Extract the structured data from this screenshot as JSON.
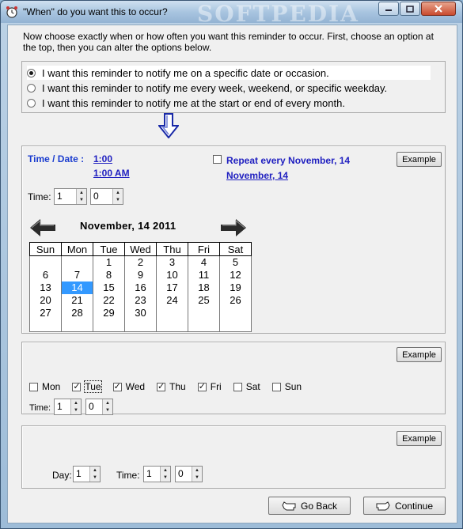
{
  "window": {
    "title": "\"When\" do you want this to occur?",
    "watermark": "SOFTPEDIA"
  },
  "intro": "Now choose exactly when or how often you want this reminder to occur.  First, choose an option at the top, then you can alter the options below.",
  "options": [
    {
      "label": "I want this reminder to notify me on a specific date or occasion.",
      "selected": true
    },
    {
      "label": "I want this reminder to notify me every week, weekend, or specific weekday.",
      "selected": false
    },
    {
      "label": "I want this reminder to notify me at the start or end of every month.",
      "selected": false
    }
  ],
  "date_panel": {
    "time_date_label": "Time / Date :",
    "time_link": "1:00",
    "time_ampm_link": "1:00 AM",
    "repeat_label": "Repeat every November, 14",
    "repeat_checked": false,
    "repeat_date_link": "November, 14",
    "example_label": "Example",
    "time_label": "Time:",
    "hour_value": "1",
    "minute_value": "0",
    "calendar": {
      "title": "November, 14  2011",
      "headers": [
        "Sun",
        "Mon",
        "Tue",
        "Wed",
        "Thu",
        "Fri",
        "Sat"
      ],
      "weeks": [
        [
          "",
          "",
          "1",
          "2",
          "3",
          "4",
          "5"
        ],
        [
          "6",
          "7",
          "8",
          "9",
          "10",
          "11",
          "12"
        ],
        [
          "13",
          "14",
          "15",
          "16",
          "17",
          "18",
          "19"
        ],
        [
          "20",
          "21",
          "22",
          "23",
          "24",
          "25",
          "26"
        ],
        [
          "27",
          "28",
          "29",
          "30",
          "",
          "",
          ""
        ],
        [
          "",
          "",
          "",
          "",
          "",
          "",
          ""
        ]
      ],
      "selected_day": "14"
    }
  },
  "weekly_panel": {
    "example_label": "Example",
    "days": [
      {
        "label": "Mon",
        "checked": false
      },
      {
        "label": "Tue",
        "checked": true
      },
      {
        "label": "Wed",
        "checked": true
      },
      {
        "label": "Thu",
        "checked": true
      },
      {
        "label": "Fri",
        "checked": true
      },
      {
        "label": "Sat",
        "checked": false
      },
      {
        "label": "Sun",
        "checked": false
      }
    ],
    "time_label": "Time:",
    "hour_value": "1",
    "minute_value": "0"
  },
  "monthly_panel": {
    "example_label": "Example",
    "day_label": "Day:",
    "day_value": "1",
    "time_label": "Time:",
    "hour_value": "1",
    "minute_value": "0"
  },
  "buttons": {
    "back": "Go Back",
    "continue": "Continue"
  },
  "colors": {
    "link": "#1f1fc0",
    "selected_day": "#3399ff",
    "close_button": "#c94a2e"
  }
}
